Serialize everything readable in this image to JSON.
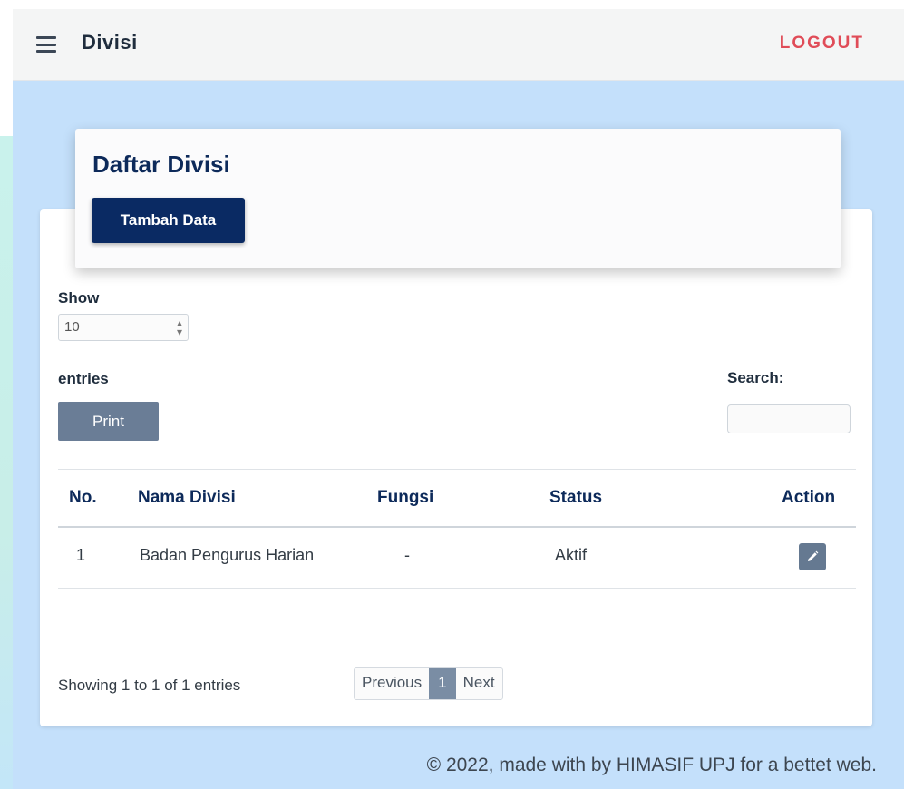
{
  "header": {
    "title": "Divisi",
    "logout_label": "LOGOUT"
  },
  "card": {
    "title": "Daftar Divisi",
    "add_button": "Tambah Data"
  },
  "controls": {
    "show_label": "Show",
    "entries_value": "10",
    "entries_label": "entries",
    "print_label": "Print",
    "search_label": "Search:",
    "search_value": ""
  },
  "table": {
    "headers": {
      "no": "No.",
      "nama": "Nama Divisi",
      "fungsi": "Fungsi",
      "status": "Status",
      "action": "Action"
    },
    "rows": [
      {
        "no": "1",
        "nama": "Badan Pengurus Harian",
        "fungsi": "-",
        "status": "Aktif",
        "action_icon": "edit-icon"
      }
    ]
  },
  "pagination": {
    "info": "Showing 1 to 1 of 1 entries",
    "previous": "Previous",
    "current_page": "1",
    "next": "Next"
  },
  "footer": {
    "copyright": "© 2022, made with by HIMASIF UPJ for a bettet web."
  },
  "colors": {
    "accent": "#0a2a63",
    "logout": "#e04c58",
    "background": "#c4e0fb"
  }
}
